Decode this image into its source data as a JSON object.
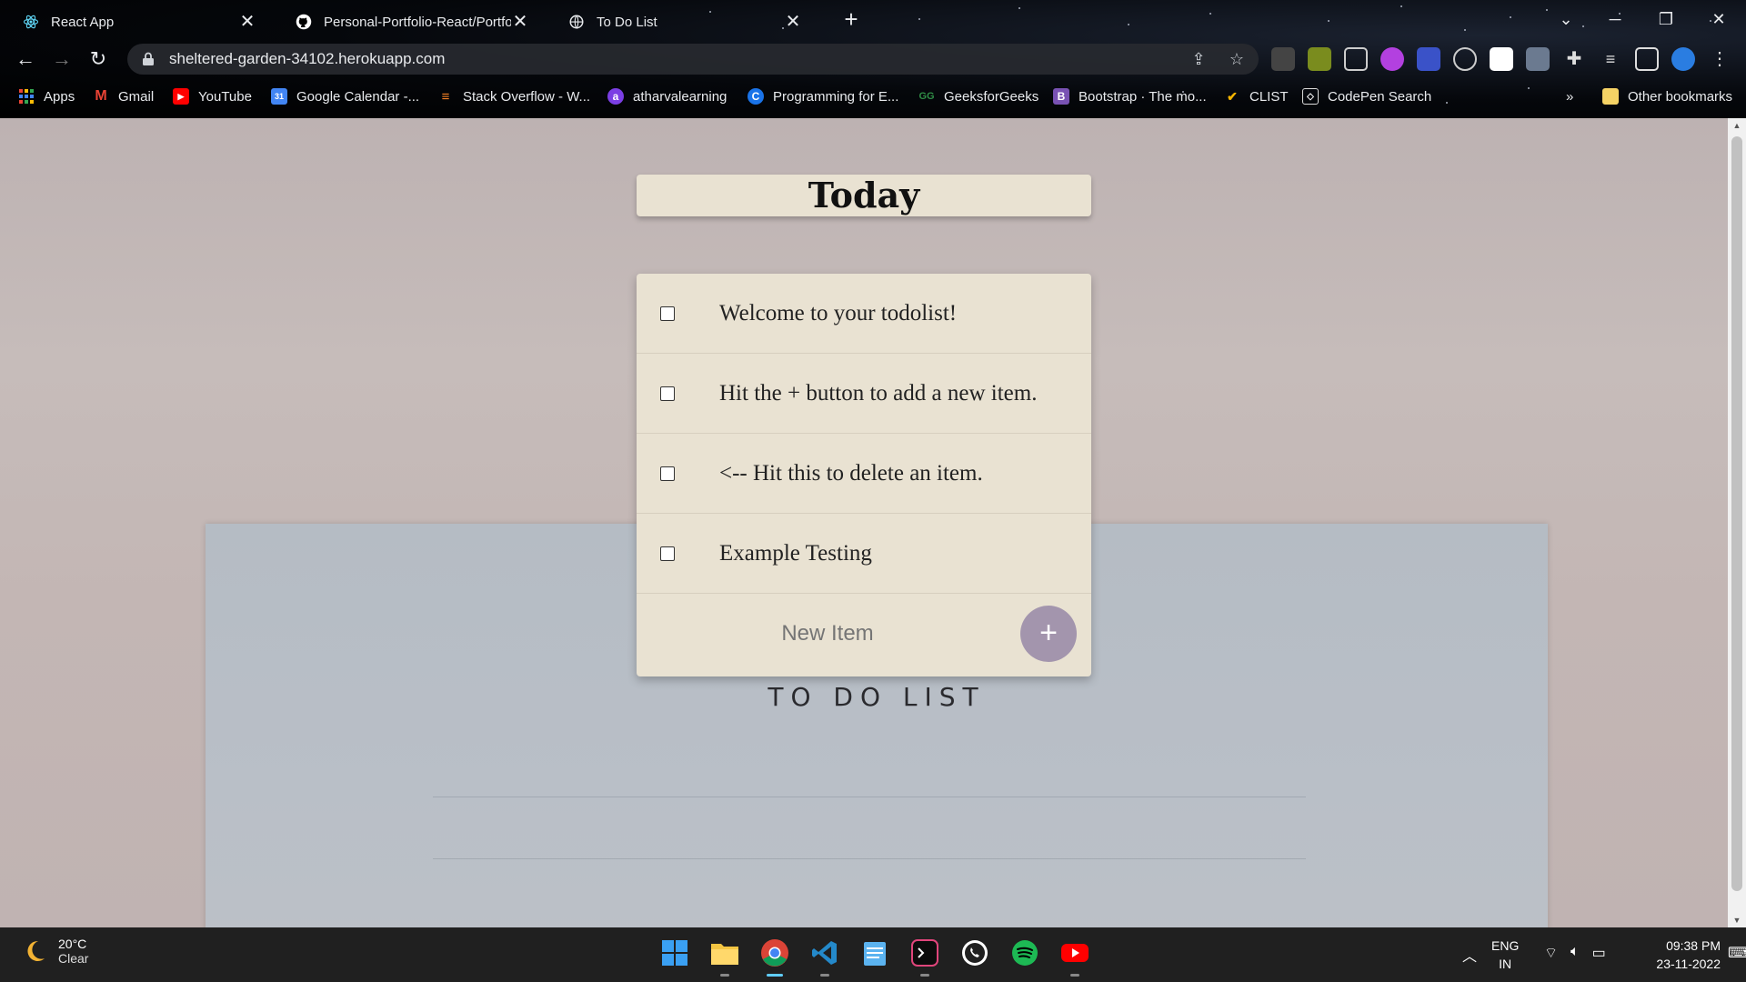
{
  "browser": {
    "tabs": [
      {
        "title": "React App",
        "icon": "react-icon"
      },
      {
        "title": "Personal-Portfolio-React/Portfolio",
        "icon": "github-icon"
      },
      {
        "title": "To Do List",
        "icon": "globe-icon"
      }
    ],
    "close_glyph": "✕",
    "new_tab_glyph": "+",
    "url": "sheltered-garden-34102.herokuapp.com",
    "bookmarks": [
      {
        "label": "Apps",
        "icon": "apps-grid-icon"
      },
      {
        "label": "Gmail",
        "icon": "gmail-icon"
      },
      {
        "label": "YouTube",
        "icon": "youtube-icon"
      },
      {
        "label": "Google Calendar -...",
        "icon": "calendar-icon"
      },
      {
        "label": "Stack Overflow - W...",
        "icon": "stackoverflow-icon"
      },
      {
        "label": "atharvalearning",
        "icon": "atharva-icon"
      },
      {
        "label": "Programming for E...",
        "icon": "codechef-icon"
      },
      {
        "label": "GeeksforGeeks",
        "icon": "gfg-icon"
      },
      {
        "label": "Bootstrap · The mo...",
        "icon": "bootstrap-icon"
      },
      {
        "label": "CLIST",
        "icon": "clist-icon"
      },
      {
        "label": "CodePen Search",
        "icon": "codepen-icon"
      }
    ],
    "more_bookmarks": "»",
    "other_bookmarks": "Other bookmarks"
  },
  "page": {
    "heading": "Today",
    "items": [
      {
        "text": "Welcome to your todolist!",
        "checked": false
      },
      {
        "text": "Hit the + button to add a new item.",
        "checked": false
      },
      {
        "text": "<-- Hit this to delete an item.",
        "checked": false
      },
      {
        "text": "Example Testing",
        "checked": false
      }
    ],
    "new_item_placeholder": "New Item",
    "add_button": "+",
    "background_title": "TO DO LIST"
  },
  "taskbar": {
    "weather_temp": "20°C",
    "weather_condition": "Clear",
    "apps": [
      "start-icon",
      "file-explorer-icon",
      "chrome-icon",
      "vscode-icon",
      "notepad-icon",
      "terminal-icon",
      "whatsapp-icon",
      "spotify-icon",
      "youtube-app-icon"
    ],
    "lang_line1": "ENG",
    "lang_line2": "IN",
    "time": "09:38 PM",
    "date": "23-11-2022"
  },
  "colors": {
    "card": "#e9e2d2",
    "add_button": "#a395ad",
    "page_bg": "#c3b6b4",
    "paper": "#b8bec6"
  }
}
